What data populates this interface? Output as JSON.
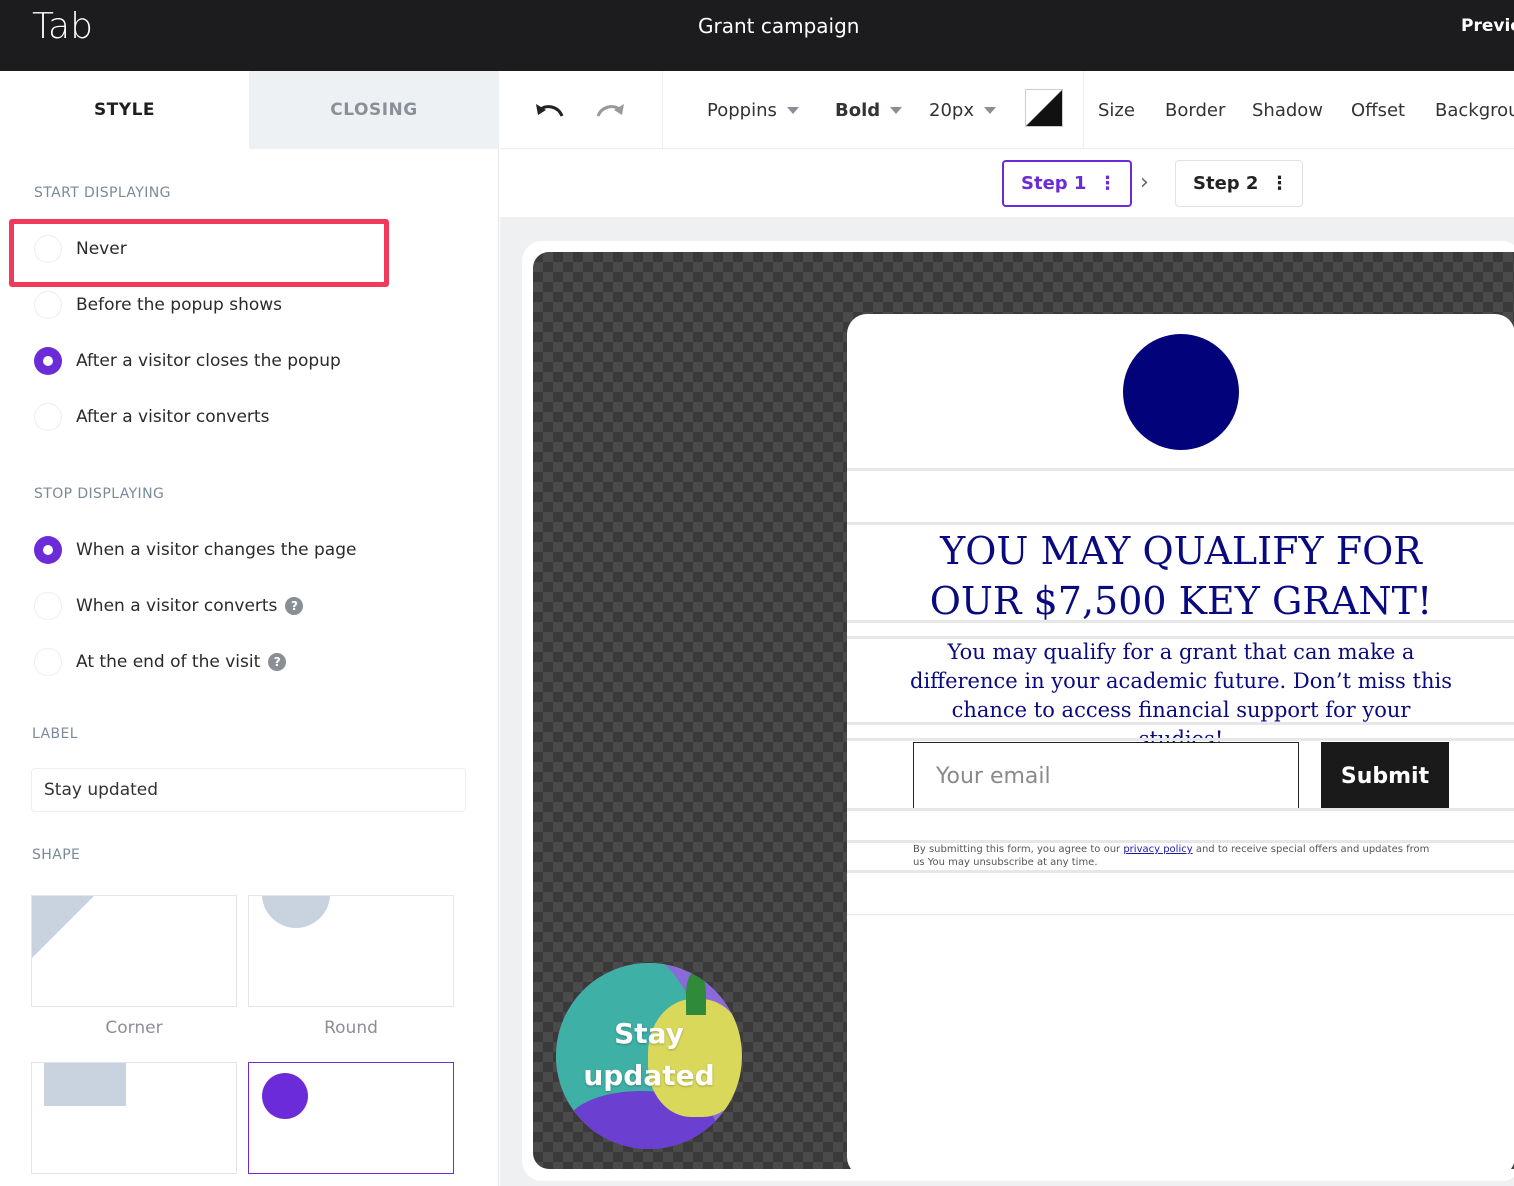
{
  "header": {
    "app_title": "Tab",
    "campaign_name": "Grant campaign",
    "preview_label": "Previe"
  },
  "sidebar": {
    "tabs": [
      {
        "label": "STYLE",
        "active": true
      },
      {
        "label": "CLOSING",
        "active": false
      }
    ],
    "start_displaying": {
      "title": "START DISPLAYING",
      "options": [
        {
          "label": "Never",
          "checked": false
        },
        {
          "label": "Before the popup shows",
          "checked": false
        },
        {
          "label": "After a visitor closes the popup",
          "checked": true
        },
        {
          "label": "After a visitor converts",
          "checked": false
        }
      ]
    },
    "stop_displaying": {
      "title": "STOP DISPLAYING",
      "options": [
        {
          "label": "When a visitor changes the page",
          "checked": true
        },
        {
          "label": "When a visitor converts",
          "checked": false,
          "help": "?"
        },
        {
          "label": "At the end of the visit",
          "checked": false,
          "help": "?"
        }
      ]
    },
    "label_section": {
      "title": "LABEL",
      "value": "Stay updated"
    },
    "shape_section": {
      "title": "SHAPE",
      "shapes": [
        {
          "caption": "Corner",
          "selected": false
        },
        {
          "caption": "Round",
          "selected": false
        },
        {
          "caption": "",
          "selected": false
        },
        {
          "caption": "",
          "selected": true
        }
      ]
    }
  },
  "toolbar": {
    "font_family": "Poppins",
    "font_weight": "Bold",
    "font_size": "20px",
    "menu": [
      "Size",
      "Border",
      "Shadow",
      "Offset",
      "Backgrou"
    ]
  },
  "steps": [
    {
      "label": "Step 1",
      "active": true
    },
    {
      "label": "Step 2",
      "active": false
    }
  ],
  "popup": {
    "headline_line1": "YOU MAY QUALIFY FOR",
    "headline_line2": "OUR $7,500 KEY GRANT!",
    "subtext_line1": "You may qualify for a grant that can make a",
    "subtext_line2": "difference in your academic future. Don’t miss this",
    "subtext_line3": "chance to access financial support for your studies!",
    "email_placeholder": "Your email",
    "submit_label": "Submit",
    "legal_before": "By submitting this form, you agree to our ",
    "legal_link": "privacy policy",
    "legal_after": " and to receive special offers and updates from us You may unsubscribe at any time."
  },
  "tab_widget": {
    "line1": "Stay",
    "line2": "updated"
  },
  "colors": {
    "accent": "#6c2bd9",
    "highlight": "#f03a5a",
    "headline": "#0a0a80",
    "logo": "#02027a"
  }
}
